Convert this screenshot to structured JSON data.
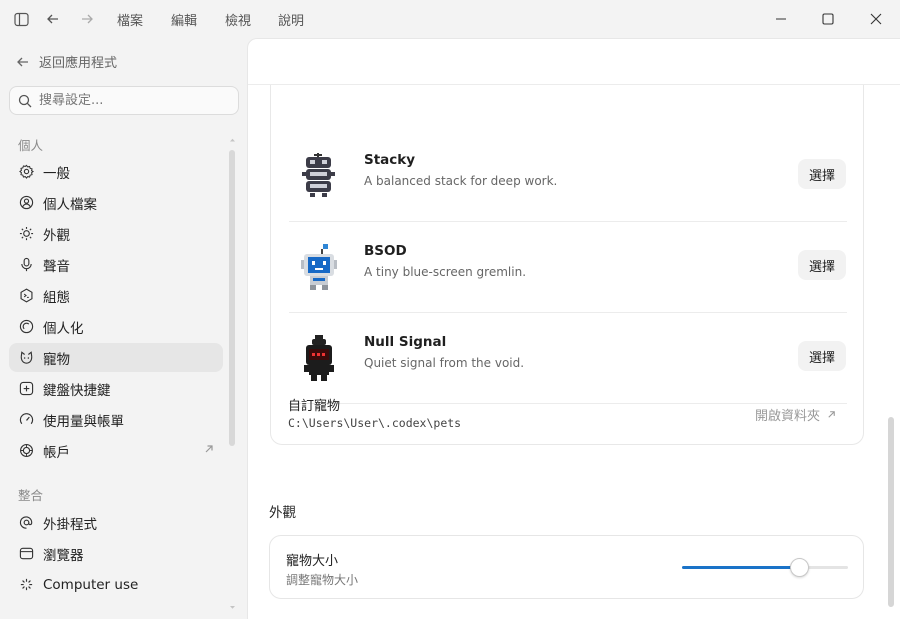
{
  "titlebar": {
    "menus": [
      "檔案",
      "編輯",
      "檢視",
      "說明"
    ]
  },
  "sidebar": {
    "back_label": "返回應用程式",
    "search_placeholder": "搜尋設定...",
    "sections": [
      {
        "title": "個人",
        "items": [
          {
            "label": "一般",
            "icon": "gear-icon"
          },
          {
            "label": "個人檔案",
            "icon": "user-circle-icon"
          },
          {
            "label": "外觀",
            "icon": "sun-icon"
          },
          {
            "label": "聲音",
            "icon": "microphone-icon"
          },
          {
            "label": "組態",
            "icon": "terminal-icon"
          },
          {
            "label": "個人化",
            "icon": "personalize-icon"
          },
          {
            "label": "寵物",
            "icon": "pet-icon",
            "active": true
          },
          {
            "label": "鍵盤快捷鍵",
            "icon": "keyboard-icon"
          },
          {
            "label": "使用量與帳單",
            "icon": "gauge-icon"
          },
          {
            "label": "帳戶",
            "icon": "account-icon",
            "external": true
          }
        ]
      },
      {
        "title": "整合",
        "items": [
          {
            "label": "外掛程式",
            "icon": "at-icon"
          },
          {
            "label": "瀏覽器",
            "icon": "browser-icon"
          },
          {
            "label": "Computer use",
            "icon": "cursor-sparkle-icon"
          }
        ]
      }
    ]
  },
  "pets": {
    "choose_label": "選擇",
    "items": [
      {
        "name": "Stacky",
        "description": "A balanced stack for deep work."
      },
      {
        "name": "BSOD",
        "description": "A tiny blue-screen gremlin."
      },
      {
        "name": "Null Signal",
        "description": "Quiet signal from the void."
      }
    ],
    "custom": {
      "label": "自訂寵物",
      "path": "C:\\Users\\User\\.codex\\pets",
      "open_folder_label": "開啟資料夾"
    }
  },
  "appearance": {
    "heading": "外觀",
    "size_label": "寵物大小",
    "size_description": "調整寵物大小",
    "size_value": 0.71
  },
  "colors": {
    "accent": "#1a73c8"
  }
}
